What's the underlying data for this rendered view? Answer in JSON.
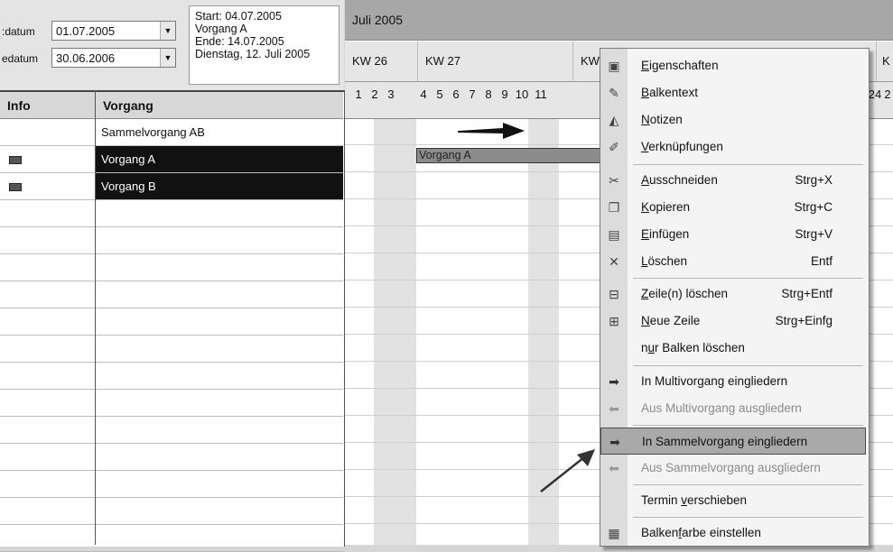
{
  "controls": {
    "start_label": ":datum",
    "start_value": "01.07.2005",
    "end_label": "edatum",
    "end_value": "30.06.2006",
    "tooltip_lines": [
      "Start: 04.07.2005",
      "Vorgang A",
      "Ende: 14.07.2005",
      "Dienstag, 12. Juli 2005"
    ]
  },
  "table": {
    "headers": [
      "Info",
      "Vorgang"
    ],
    "rows": [
      "Sammelvorgang AB",
      "Vorgang A",
      "Vorgang B"
    ]
  },
  "gantt": {
    "month": "Juli 2005",
    "weeks": [
      "KW 26",
      "KW 27",
      "KW",
      "K"
    ],
    "days": [
      "1",
      "2",
      "3",
      "4",
      "5",
      "6",
      "7",
      "8",
      "9",
      "10",
      "11"
    ],
    "days_right": [
      "24",
      "2"
    ],
    "bar_label": "Vorgang A"
  },
  "menu": {
    "items": [
      {
        "label": "Eigenschaften",
        "accel": "E",
        "shortcut": "",
        "icon": "properties-icon",
        "disabled": false
      },
      {
        "label": "Balkentext",
        "accel": "B",
        "shortcut": "",
        "icon": "pencil-icon",
        "disabled": false
      },
      {
        "label": "Notizen",
        "accel": "N",
        "shortcut": "",
        "icon": "notes-icon",
        "disabled": false
      },
      {
        "label": "Verknüpfungen",
        "accel": "V",
        "shortcut": "",
        "icon": "link-icon",
        "disabled": false
      },
      {
        "label": "Ausschneiden",
        "accel": "A",
        "shortcut": "Strg+X",
        "icon": "scissors-icon",
        "disabled": false
      },
      {
        "label": "Kopieren",
        "accel": "K",
        "shortcut": "Strg+C",
        "icon": "copy-icon",
        "disabled": false
      },
      {
        "label": "Einfügen",
        "accel": "E",
        "shortcut": "Strg+V",
        "icon": "paste-icon",
        "disabled": false
      },
      {
        "label": "Löschen",
        "accel": "L",
        "shortcut": "Entf",
        "icon": "delete-icon",
        "disabled": false
      },
      {
        "label": "Zeile(n) löschen",
        "accel": "Z",
        "shortcut": "Strg+Entf",
        "icon": "delete-row-icon",
        "disabled": false
      },
      {
        "label": "Neue Zeile",
        "accel": "N",
        "shortcut": "Strg+Einfg",
        "icon": "new-row-icon",
        "disabled": false
      },
      {
        "label": "nur Balken löschen",
        "accel": "u",
        "shortcut": "",
        "icon": "",
        "disabled": false
      },
      {
        "label": "In Multivorgang eingliedern",
        "accel": "",
        "shortcut": "",
        "icon": "arrow-right-icon",
        "disabled": false
      },
      {
        "label": "Aus Multivorgang ausgliedern",
        "accel": "",
        "shortcut": "",
        "icon": "arrow-left-icon",
        "disabled": true
      },
      {
        "label": "In Sammelvorgang eingliedern",
        "accel": "",
        "shortcut": "",
        "icon": "arrow-right-icon",
        "disabled": false,
        "highlighted": true
      },
      {
        "label": "Aus Sammelvorgang ausgliedern",
        "accel": "",
        "shortcut": "",
        "icon": "arrow-left-icon",
        "disabled": true
      },
      {
        "label": "Termin verschieben",
        "accel": "v",
        "shortcut": "",
        "icon": "",
        "disabled": false
      },
      {
        "label": "Balkenfarbe einstellen",
        "accel": "f",
        "shortcut": "",
        "icon": "color-icon",
        "disabled": false
      }
    ]
  }
}
